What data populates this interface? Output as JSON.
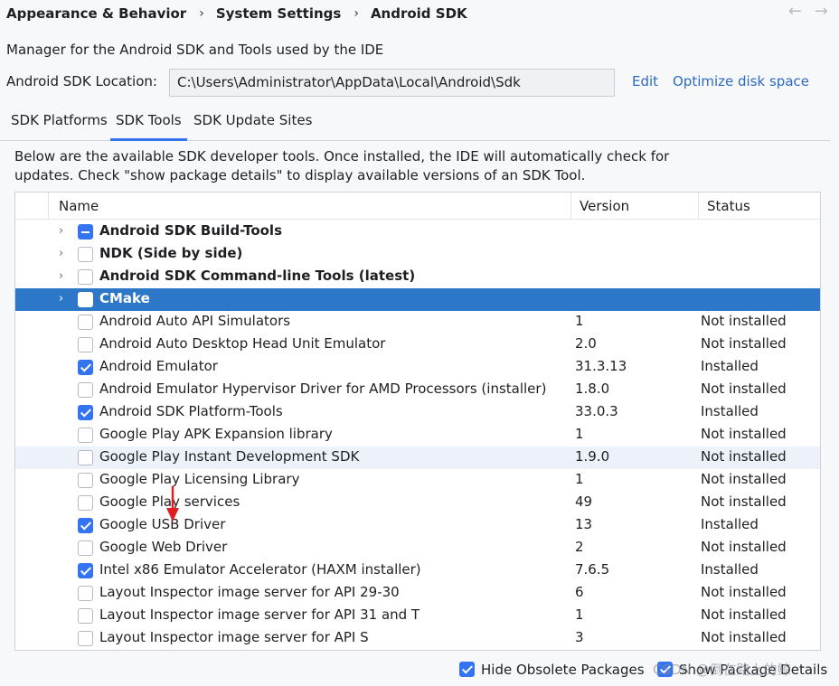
{
  "breadcrumb": [
    "Appearance & Behavior",
    "System Settings",
    "Android SDK"
  ],
  "nav": {
    "back_icon": "arrow-left-icon",
    "forward_icon": "arrow-right-icon"
  },
  "description": "Manager for the Android SDK and Tools used by the IDE",
  "sdk_location": {
    "label": "Android SDK Location:",
    "value": "C:\\Users\\Administrator\\AppData\\Local\\Android\\Sdk",
    "edit_label": "Edit",
    "optimize_label": "Optimize disk space"
  },
  "tabs": [
    {
      "label": "SDK Platforms",
      "active": false
    },
    {
      "label": "SDK Tools",
      "active": true
    },
    {
      "label": "SDK Update Sites",
      "active": false
    }
  ],
  "intro_text": "Below are the available SDK developer tools. Once installed, the IDE will automatically check for updates. Check \"show package details\" to display available versions of an SDK Tool.",
  "table": {
    "columns": [
      "Name",
      "Version",
      "Status"
    ],
    "rows": [
      {
        "name": "Android SDK Build-Tools",
        "version": "",
        "status": "",
        "check": "partial",
        "group": true,
        "selected": false
      },
      {
        "name": "NDK (Side by side)",
        "version": "",
        "status": "",
        "check": "none",
        "group": true,
        "selected": false
      },
      {
        "name": "Android SDK Command-line Tools (latest)",
        "version": "",
        "status": "",
        "check": "none",
        "group": true,
        "selected": false
      },
      {
        "name": "CMake",
        "version": "",
        "status": "",
        "check": "none",
        "group": true,
        "selected": true
      },
      {
        "name": "Android Auto API Simulators",
        "version": "1",
        "status": "Not installed",
        "check": "none"
      },
      {
        "name": "Android Auto Desktop Head Unit Emulator",
        "version": "2.0",
        "status": "Not installed",
        "check": "none"
      },
      {
        "name": "Android Emulator",
        "version": "31.3.13",
        "status": "Installed",
        "check": "checked"
      },
      {
        "name": "Android Emulator Hypervisor Driver for AMD Processors (installer)",
        "version": "1.8.0",
        "status": "Not installed",
        "check": "none"
      },
      {
        "name": "Android SDK Platform-Tools",
        "version": "33.0.3",
        "status": "Installed",
        "check": "checked"
      },
      {
        "name": "Google Play APK Expansion library",
        "version": "1",
        "status": "Not installed",
        "check": "none"
      },
      {
        "name": "Google Play Instant Development SDK",
        "version": "1.9.0",
        "status": "Not installed",
        "check": "none",
        "hover": true
      },
      {
        "name": "Google Play Licensing Library",
        "version": "1",
        "status": "Not installed",
        "check": "none"
      },
      {
        "name": "Google Play services",
        "version": "49",
        "status": "Not installed",
        "check": "none"
      },
      {
        "name": "Google USB Driver",
        "version": "13",
        "status": "Installed",
        "check": "checked"
      },
      {
        "name": "Google Web Driver",
        "version": "2",
        "status": "Not installed",
        "check": "none"
      },
      {
        "name": "Intel x86 Emulator Accelerator (HAXM installer)",
        "version": "7.6.5",
        "status": "Installed",
        "check": "checked"
      },
      {
        "name": "Layout Inspector image server for API 29-30",
        "version": "6",
        "status": "Not installed",
        "check": "none"
      },
      {
        "name": "Layout Inspector image server for API 31 and T",
        "version": "1",
        "status": "Not installed",
        "check": "none"
      },
      {
        "name": "Layout Inspector image server for API S",
        "version": "3",
        "status": "Not installed",
        "check": "none"
      }
    ]
  },
  "footer": {
    "hide_obsolete_label": "Hide Obsolete Packages",
    "show_details_label": "Show Package Details",
    "watermark": "CSDN @倒在路上的鲸"
  },
  "colors": {
    "accent": "#3574f0",
    "selected_row": "#2c77c8",
    "link": "#2d6bc2",
    "annotation": "#e02020"
  }
}
